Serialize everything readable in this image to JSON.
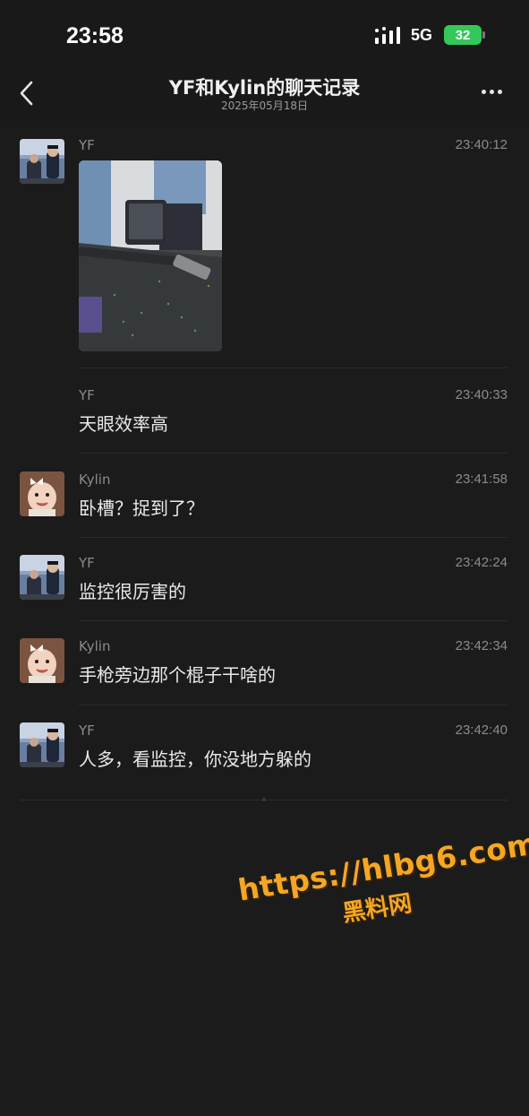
{
  "status_bar": {
    "time": "23:58",
    "network": "5G",
    "battery": "32",
    "signal_icon": "signal-bars-icon",
    "battery_color": "#34c759"
  },
  "header": {
    "back_icon": "chevron-left-icon",
    "title": "YF和Kylin的聊天记录",
    "subtitle": "2025年05月18日",
    "more_icon": "more-dots-icon"
  },
  "messages": [
    {
      "sender": "YF",
      "time": "23:40:12",
      "type": "image",
      "image_desc": "photo-of-desk"
    },
    {
      "sender": "YF",
      "time": "23:40:33",
      "type": "text",
      "text": "天眼效率高"
    },
    {
      "sender": "Kylin",
      "time": "23:41:58",
      "type": "text",
      "text": "卧槽？捉到了？"
    },
    {
      "sender": "YF",
      "time": "23:42:24",
      "type": "text",
      "text": "监控很厉害的"
    },
    {
      "sender": "Kylin",
      "time": "23:42:34",
      "type": "text",
      "text": "手枪旁边那个棍子干啥的"
    },
    {
      "sender": "YF",
      "time": "23:42:40",
      "type": "text",
      "text": "人多，看监控，你没地方躲的"
    }
  ],
  "watermark": {
    "url": "https://hlbg6.com",
    "label": "黑料网",
    "color": "#f5a623"
  }
}
